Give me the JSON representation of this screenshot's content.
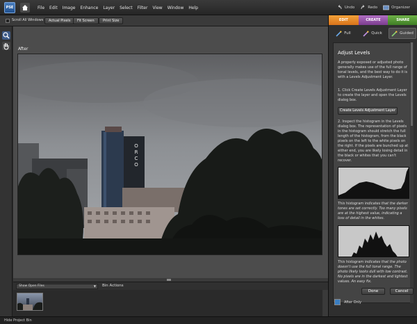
{
  "menubar": {
    "logo": "PSE",
    "menus": [
      "File",
      "Edit",
      "Image",
      "Enhance",
      "Layer",
      "Select",
      "Filter",
      "View",
      "Window",
      "Help"
    ],
    "undo": "Undo",
    "redo": "Redo",
    "organizer": "Organizer"
  },
  "options": {
    "scroll_all": "Scroll All Windows",
    "actual_pixels": "Actual Pixels",
    "fit_screen": "Fit Screen",
    "print_size": "Print Size"
  },
  "canvas": {
    "view_label": "After"
  },
  "bin": {
    "select_value": "Show Open Files",
    "actions": "Bin Actions",
    "hide": "Hide Project Bin"
  },
  "panel": {
    "modes": [
      "EDIT",
      "CREATE",
      "SHARE"
    ],
    "submodes": [
      "Full",
      "Quick",
      "Guided"
    ],
    "title": "Adjust Levels",
    "intro": "A properly exposed or adjusted photo generally makes use of the full range of tonal levels, and the best way to do it is with a Levels Adjustment Layer.",
    "step1": "1. Click Create Levels Adjustment Layer to create the layer and open the Levels dialog box.",
    "create_button": "Create Levels Adjustment Layer",
    "step2": "2. Inspect the histogram in the Levels dialog box. The representation of pixels in the histogram should stretch the full length of the histogram, from the black pixels on the left to the white pixels on the right. If the pixels are bunched up at either end, you are likely losing detail in the black or whites that you can't recover.",
    "hist1_caption": "This histogram indicates that the darker tones are set correctly. Too many pixels are at the highest value, indicating a loss of detail in the whites.",
    "hist2_caption": "This histogram indicates that the photo doesn't use the full tonal range. The photo likely looks dull with low contrast. No pixels are in the darkest and lightest values. An easy fix.",
    "done": "Done",
    "cancel": "Cancel",
    "after_only": "After Only"
  },
  "photo": {
    "sign_letters": [
      "O",
      "R",
      "C",
      "O"
    ]
  },
  "colors": {
    "edit_tab": "#e8892a",
    "create_tab": "#9a55ad",
    "share_tab": "#5a9c36"
  }
}
